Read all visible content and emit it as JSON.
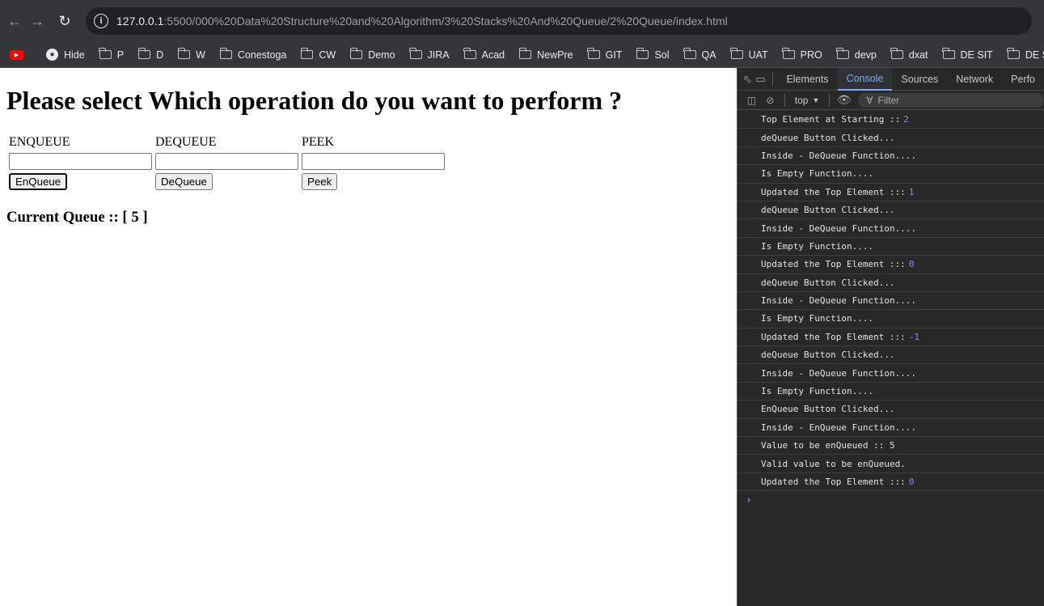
{
  "browser": {
    "url_host": "127.0.0.1",
    "url_path": ":5500/000%20Data%20Structure%20and%20Algorithm/3%20Stacks%20And%20Queue/2%20Queue/index.html"
  },
  "bookmarks": [
    {
      "label": "",
      "icon": "youtube-icon"
    },
    {
      "label": "Hide",
      "icon": "globe-icon"
    },
    {
      "label": "P",
      "icon": "folder-icon"
    },
    {
      "label": "D",
      "icon": "folder-icon"
    },
    {
      "label": "W",
      "icon": "folder-icon"
    },
    {
      "label": "Conestoga",
      "icon": "folder-icon"
    },
    {
      "label": "CW",
      "icon": "folder-icon"
    },
    {
      "label": "Demo",
      "icon": "folder-icon"
    },
    {
      "label": "JIRA",
      "icon": "folder-icon"
    },
    {
      "label": "Acad",
      "icon": "folder-icon"
    },
    {
      "label": "NewPre",
      "icon": "folder-icon"
    },
    {
      "label": "GIT",
      "icon": "folder-icon"
    },
    {
      "label": "Sol",
      "icon": "folder-icon"
    },
    {
      "label": "QA",
      "icon": "folder-icon"
    },
    {
      "label": "UAT",
      "icon": "folder-icon"
    },
    {
      "label": "PRO",
      "icon": "folder-icon"
    },
    {
      "label": "devp",
      "icon": "folder-icon"
    },
    {
      "label": "dxat",
      "icon": "folder-icon"
    },
    {
      "label": "DE SIT",
      "icon": "folder-icon"
    },
    {
      "label": "DE SIT",
      "icon": "folder-icon"
    }
  ],
  "page": {
    "heading": "Please select Which operation do you want to perform ?",
    "enqueue": {
      "label": "ENQUEUE",
      "value": "",
      "button": "EnQueue"
    },
    "dequeue": {
      "label": "DEQUEUE",
      "value": "",
      "button": "DeQueue"
    },
    "peek": {
      "label": "PEEK",
      "value": "",
      "button": "Peek"
    },
    "current_queue": "Current Queue :: [ 5 ]"
  },
  "devtools": {
    "tabs": [
      "Elements",
      "Console",
      "Sources",
      "Network",
      "Perfo"
    ],
    "active_tab": "Console",
    "context": "top",
    "filter_placeholder": "Filter",
    "console": [
      {
        "text": "Top Element at Starting ::",
        "num": "2"
      },
      {
        "text": "deQueue Button Clicked...",
        "num": ""
      },
      {
        "text": "Inside - DeQueue Function....",
        "num": ""
      },
      {
        "text": "Is Empty Function....",
        "num": ""
      },
      {
        "text": "Updated the Top Element :::",
        "num": "1"
      },
      {
        "text": "deQueue Button Clicked...",
        "num": ""
      },
      {
        "text": "Inside - DeQueue Function....",
        "num": ""
      },
      {
        "text": "Is Empty Function....",
        "num": ""
      },
      {
        "text": "Updated the Top Element :::",
        "num": "0"
      },
      {
        "text": "deQueue Button Clicked...",
        "num": ""
      },
      {
        "text": "Inside - DeQueue Function....",
        "num": ""
      },
      {
        "text": "Is Empty Function....",
        "num": ""
      },
      {
        "text": "Updated the Top Element :::",
        "num": "-1"
      },
      {
        "text": "deQueue Button Clicked...",
        "num": ""
      },
      {
        "text": "Inside - DeQueue Function....",
        "num": ""
      },
      {
        "text": "Is Empty Function....",
        "num": ""
      },
      {
        "text": "EnQueue Button Clicked...",
        "num": ""
      },
      {
        "text": "Inside - EnQueue Function....",
        "num": ""
      },
      {
        "text": "Value to be enQueued :: 5",
        "num": ""
      },
      {
        "text": "Valid value to be enQueued.",
        "num": ""
      },
      {
        "text": "Updated the Top Element :::",
        "num": "0"
      }
    ]
  }
}
